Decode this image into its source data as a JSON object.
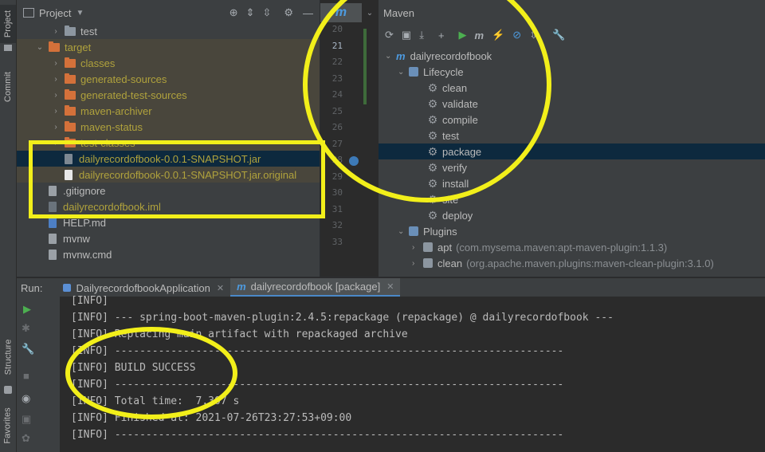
{
  "project_panel": {
    "title": "Project",
    "items": [
      {
        "label": "test",
        "kind": "folder-grey",
        "depth": 1,
        "chevron": "›"
      },
      {
        "label": "target",
        "kind": "folder-orange",
        "depth": 0,
        "chevron": "⌄"
      },
      {
        "label": "classes",
        "kind": "folder-orange",
        "depth": 1,
        "chevron": "›"
      },
      {
        "label": "generated-sources",
        "kind": "folder-orange",
        "depth": 1,
        "chevron": "›"
      },
      {
        "label": "generated-test-sources",
        "kind": "folder-orange",
        "depth": 1,
        "chevron": "›"
      },
      {
        "label": "maven-archiver",
        "kind": "folder-orange",
        "depth": 1,
        "chevron": "›"
      },
      {
        "label": "maven-status",
        "kind": "folder-orange",
        "depth": 1,
        "chevron": "›"
      },
      {
        "label": "test-classes",
        "kind": "folder-orange",
        "depth": 1,
        "chevron": "›"
      },
      {
        "label": "dailyrecordofbook-0.0.1-SNAPSHOT.jar",
        "kind": "jar",
        "depth": 1,
        "chevron": ""
      },
      {
        "label": "dailyrecordofbook-0.0.1-SNAPSHOT.jar.original",
        "kind": "file",
        "depth": 1,
        "chevron": ""
      },
      {
        "label": ".gitignore",
        "kind": "git",
        "depth": 0,
        "chevron": ""
      },
      {
        "label": "dailyrecordofbook.iml",
        "kind": "iml",
        "depth": 0,
        "chevron": ""
      },
      {
        "label": "HELP.md",
        "kind": "md",
        "depth": 0,
        "chevron": ""
      },
      {
        "label": "mvnw",
        "kind": "script",
        "depth": 0,
        "chevron": ""
      },
      {
        "label": "mvnw.cmd",
        "kind": "script",
        "depth": 0,
        "chevron": ""
      }
    ]
  },
  "left_stripe": {
    "tabs": [
      "Project",
      "Commit",
      "Structure",
      "Favorites"
    ]
  },
  "editor": {
    "tab_label": "m",
    "line_numbers": [
      "20",
      "21",
      "22",
      "23",
      "24",
      "25",
      "26",
      "27",
      "28",
      "29",
      "30",
      "31",
      "32",
      "33"
    ]
  },
  "maven_panel": {
    "title": "Maven",
    "project": "dailyrecordofbook",
    "lifecycle_label": "Lifecycle",
    "lifecycle": [
      "clean",
      "validate",
      "compile",
      "test",
      "package",
      "verify",
      "install",
      "site",
      "deploy"
    ],
    "selected": "package",
    "plugins_label": "Plugins",
    "plugins": [
      {
        "name": "apt",
        "detail": "(com.mysema.maven:apt-maven-plugin:1.1.3)"
      },
      {
        "name": "clean",
        "detail": "(org.apache.maven.plugins:maven-clean-plugin:3.1.0)"
      }
    ]
  },
  "run_panel": {
    "label": "Run:",
    "tabs": [
      {
        "label": "DailyrecordofbookApplication",
        "active": false
      },
      {
        "label": "dailyrecordofbook [package]",
        "active": true
      }
    ],
    "console_lines": [
      "[INFO]",
      "[INFO] --- spring-boot-maven-plugin:2.4.5:repackage (repackage) @ dailyrecordofbook ---",
      "[INFO] Replacing main artifact with repackaged archive",
      "[INFO] ------------------------------------------------------------------------",
      "[INFO] BUILD SUCCESS",
      "[INFO] ------------------------------------------------------------------------",
      "[INFO] Total time:  7.307 s",
      "[INFO] Finished at: 2021-07-26T23:27:53+09:00",
      "[INFO] ------------------------------------------------------------------------"
    ]
  },
  "colors": {
    "highlight": "#f2ef1a",
    "selection": "#0d293e",
    "folder": "#d4713a",
    "excluded_text": "#b0a23c",
    "run_green": "#4caf50"
  }
}
